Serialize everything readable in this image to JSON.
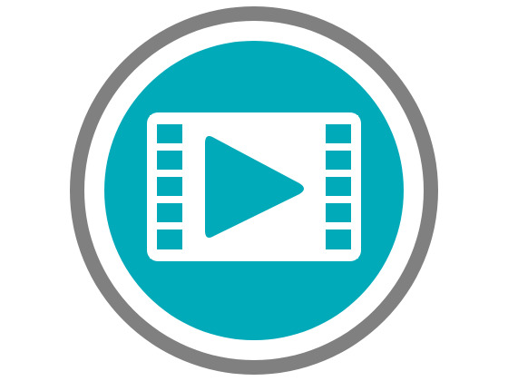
{
  "icon": {
    "name": "video-play-icon",
    "colors": {
      "ring": "#808080",
      "ring_gap": "#ffffff",
      "disc": "#00aab9",
      "glyph": "#ffffff"
    },
    "film_strip": {
      "holes_per_side": 5
    }
  }
}
